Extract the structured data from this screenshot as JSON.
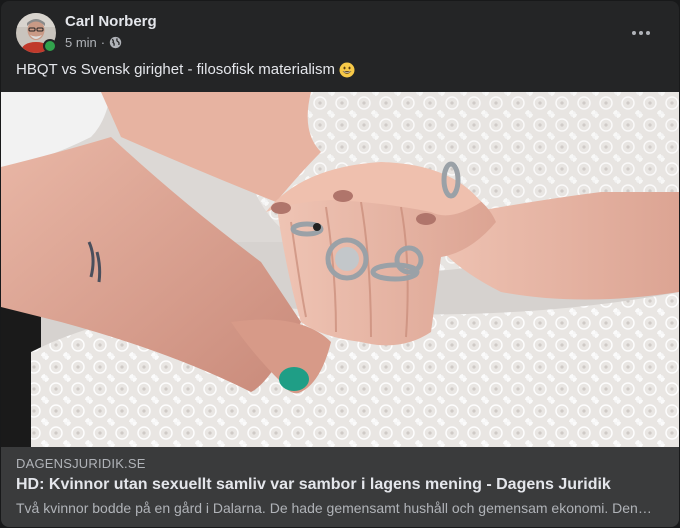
{
  "post": {
    "author": "Carl Norberg",
    "timestamp": "5 min",
    "separator": "·",
    "privacy_icon": "globe-icon",
    "text": "HBQT vs Svensk girighet - filosofisk materialism",
    "emoji": "grinning-face-emoji",
    "online_status_color": "#31a24c"
  },
  "link_preview": {
    "domain": "DAGENSJURIDIK.SE",
    "title": "HD: Kvinnor utan sexuellt samliv var sambor i lagens mening - Dagens Juridik",
    "description": "Två kvinnor bodde på en gård i Dalarna. De hade gemensamt hushåll och gemensam ekonomi. Den ena kvinnan dog och den andra ville ärva."
  },
  "menu": {
    "icon": "more-options-icon"
  }
}
